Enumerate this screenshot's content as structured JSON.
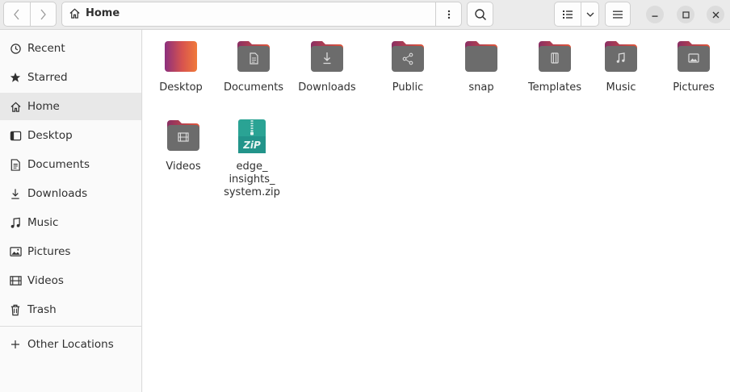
{
  "window": {
    "location_title": "Home",
    "accent_color": "#e95420"
  },
  "header": {
    "back_icon": "chevron-left-icon",
    "forward_icon": "chevron-right-icon",
    "path_icon": "home-icon",
    "path_menu_icon": "vertical-dots-icon",
    "search_icon": "search-icon",
    "view_icon": "list-view-icon",
    "view_options_icon": "chevron-down-icon",
    "menu_icon": "hamburger-icon",
    "minimize_icon": "minimize-icon",
    "maximize_icon": "maximize-icon",
    "close_icon": "close-icon"
  },
  "sidebar": {
    "items": [
      {
        "label": "Recent",
        "icon": "clock-icon"
      },
      {
        "label": "Starred",
        "icon": "star-icon"
      },
      {
        "label": "Home",
        "icon": "home-icon",
        "selected": true
      },
      {
        "label": "Desktop",
        "icon": "desktop-icon"
      },
      {
        "label": "Documents",
        "icon": "document-icon"
      },
      {
        "label": "Downloads",
        "icon": "download-icon"
      },
      {
        "label": "Music",
        "icon": "music-icon"
      },
      {
        "label": "Pictures",
        "icon": "picture-icon"
      },
      {
        "label": "Videos",
        "icon": "film-icon"
      },
      {
        "label": "Trash",
        "icon": "trash-icon"
      }
    ],
    "other_locations": {
      "label": "Other Locations",
      "icon": "plus-icon"
    }
  },
  "files": [
    {
      "label": "Desktop",
      "icon": "desktop-folder-icon"
    },
    {
      "label": "Documents",
      "icon": "documents-folder-icon"
    },
    {
      "label": "Downloads",
      "icon": "downloads-folder-icon"
    },
    {
      "label": "Public",
      "icon": "public-folder-icon"
    },
    {
      "label": "snap",
      "icon": "folder-icon"
    },
    {
      "label": "Templates",
      "icon": "templates-folder-icon"
    },
    {
      "label": "Music",
      "icon": "music-folder-icon"
    },
    {
      "label": "Pictures",
      "icon": "pictures-folder-icon"
    },
    {
      "label": "Videos",
      "icon": "videos-folder-icon"
    },
    {
      "label": "edge_\ninsights_\nsystem.zip",
      "icon": "zip-archive-icon",
      "badge": "ZiP"
    }
  ]
}
